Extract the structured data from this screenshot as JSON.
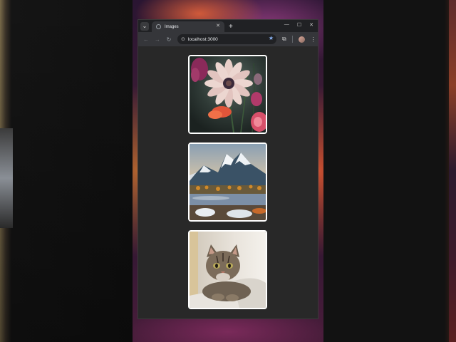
{
  "browser": {
    "tab_title": "Images",
    "tab_close_glyph": "✕",
    "new_tab_glyph": "+",
    "address": "localhost:3000",
    "icons": [
      "tab-search-icon",
      "favicon-icon",
      "close-icon",
      "new-tab-icon",
      "minimize-icon",
      "maximize-icon",
      "window-close-icon",
      "back-icon",
      "forward-icon",
      "reload-icon",
      "site-info-icon",
      "bookmark-star-icon",
      "extensions-icon",
      "profile-avatar-icon",
      "menu-kebab-icon"
    ],
    "accent_color": "#8ab4f8"
  },
  "gallery": {
    "images": [
      {
        "subject": "flower"
      },
      {
        "subject": "mountain"
      },
      {
        "subject": "cat"
      }
    ],
    "border_color": "#ffffff",
    "page_background": "#282828"
  }
}
